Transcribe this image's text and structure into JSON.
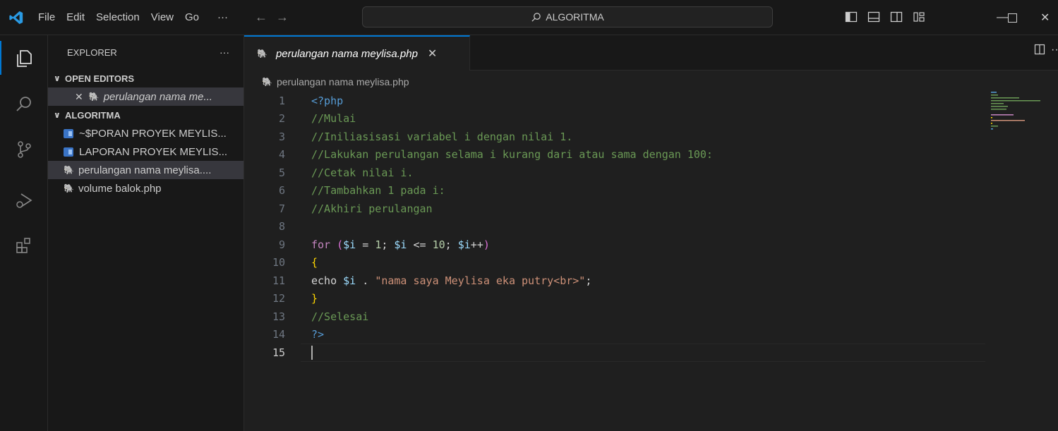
{
  "titlebar": {
    "menu": [
      "File",
      "Edit",
      "Selection",
      "View",
      "Go",
      "···"
    ],
    "search_text": "ALGORITMA"
  },
  "activitybar": {
    "items": [
      "explorer-icon",
      "search-icon",
      "source-control-icon",
      "run-debug-icon",
      "extensions-icon"
    ]
  },
  "sidebar": {
    "title": "EXPLORER",
    "more": "···",
    "open_editors_label": "OPEN EDITORS",
    "open_editors": [
      {
        "name": "perulangan nama me..."
      }
    ],
    "folder_label": "ALGORITMA",
    "files": [
      {
        "name": "~$PORAN PROYEK MEYLIS...",
        "type": "word"
      },
      {
        "name": "LAPORAN PROYEK MEYLIS...",
        "type": "word"
      },
      {
        "name": "perulangan nama meylisa....",
        "type": "php"
      },
      {
        "name": "volume balok.php",
        "type": "php"
      }
    ]
  },
  "editor": {
    "tab_label": "perulangan nama meylisa.php",
    "breadcrumb": "perulangan nama meylisa.php",
    "current_line": 15,
    "lines": [
      "<?php",
      "//Mulai",
      "//Iniliasisasi variabel i dengan nilai 1.",
      "//Lakukan perulangan selama i kurang dari atau sama dengan 100:",
      "//Cetak nilai i.",
      "//Tambahkan 1 pada i:",
      "//Akhiri perulangan",
      "",
      "for ($i = 1; $i <= 10; $i++)",
      "{",
      "echo $i . \"nama saya Meylisa eka putry<br>\";",
      "}",
      "//Selesai",
      "?>",
      ""
    ]
  },
  "colors": {
    "accent": "#0078d4",
    "comment": "#6a9955",
    "keyword": "#c586c0",
    "variable": "#9cdcfe",
    "string": "#ce9178",
    "number": "#b5cea8",
    "php_icon": "#a074c4"
  }
}
